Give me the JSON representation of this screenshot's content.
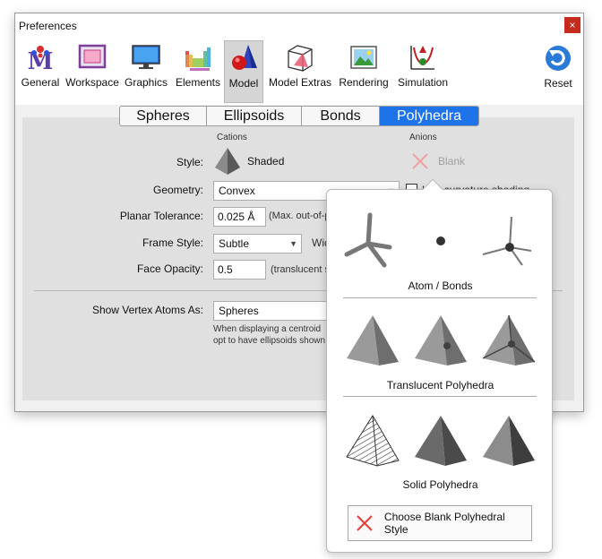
{
  "window": {
    "title": "Preferences",
    "close_glyph": "×"
  },
  "toolbar": {
    "tools": [
      {
        "label": "General",
        "icon": "general-icon"
      },
      {
        "label": "Workspace",
        "icon": "workspace-icon"
      },
      {
        "label": "Graphics",
        "icon": "graphics-icon"
      },
      {
        "label": "Elements",
        "icon": "elements-icon"
      },
      {
        "label": "Model",
        "icon": "model-icon",
        "active": true
      },
      {
        "label": "Model Extras",
        "icon": "model-extras-icon"
      },
      {
        "label": "Rendering",
        "icon": "rendering-icon"
      },
      {
        "label": "Simulation",
        "icon": "simulation-icon"
      }
    ],
    "reset_label": "Reset"
  },
  "tabs": [
    "Spheres",
    "Ellipsoids",
    "Bonds",
    "Polyhedra"
  ],
  "active_tab": "Polyhedra",
  "form": {
    "cations_header": "Cations",
    "anions_header": "Anions",
    "style_label": "Style:",
    "style_cations_value": "Shaded",
    "style_anions_value": "Blank",
    "geometry_label": "Geometry:",
    "geometry_value": "Convex",
    "curvature_label": "Use curvature shading",
    "planar_tolerance_label": "Planar Tolerance:",
    "planar_tolerance_value": "0.025 Å",
    "planar_tolerance_hint": "(Max. out-of-pl",
    "frame_style_label": "Frame Style:",
    "frame_style_value": "Subtle",
    "frame_width_label": "Wid",
    "face_opacity_label": "Face Opacity:",
    "face_opacity_value": "0.5",
    "face_opacity_hint": "(translucent st",
    "vertex_atoms_label": "Show Vertex Atoms As:",
    "vertex_atoms_value": "Spheres",
    "vertex_note_line1": "When displaying a centroid",
    "vertex_note_line2": "opt to have ellipsoids shown"
  },
  "popover": {
    "group1": "Atom / Bonds",
    "group2": "Translucent Polyhedra",
    "group3": "Solid Polyhedra",
    "blank_button": "Choose Blank Polyhedral Style"
  },
  "colors": {
    "accent": "#1e73e8",
    "close": "#c42b1c",
    "blank_x": "#e0433a"
  }
}
